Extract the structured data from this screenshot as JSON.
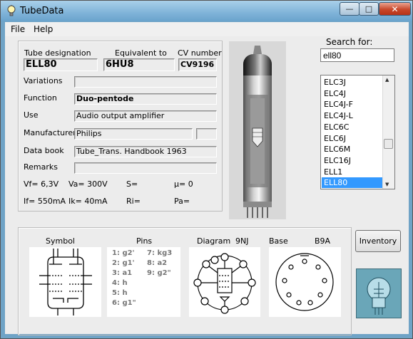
{
  "window": {
    "title": "TubeData"
  },
  "menu": {
    "file": "File",
    "help": "Help"
  },
  "search": {
    "label": "Search for:",
    "value": "ell80"
  },
  "tube_list": {
    "items": [
      "ELC3J",
      "ELC4J",
      "ELC4J-F",
      "ELC4J-L",
      "ELC6C",
      "ELC6J",
      "ELC6M",
      "ELC16J",
      "ELL1",
      "ELL80"
    ],
    "selected": "ELL80"
  },
  "info": {
    "designation_label": "Tube designation",
    "equivalent_label": "Equivalent to",
    "cv_label": "CV number",
    "designation": "ELL80",
    "equivalent": "6HU8",
    "cv": "CV9196",
    "variations_label": "Variations",
    "variations": "",
    "function_label": "Function",
    "function": "Duo-pentode",
    "use_label": "Use",
    "use": "Audio output amplifier",
    "manufacturer_label": "Manufacturer",
    "manufacturer": "Philips",
    "manufacturer_code": "",
    "databook_label": "Data book",
    "databook": "Tube_Trans. Handbook 1963",
    "remarks_label": "Remarks",
    "remarks": ""
  },
  "specs": {
    "vf": "Vf= 6,3V",
    "va": "Va=  300V",
    "s": "S=",
    "mu": "µ=   0",
    "if": "If= 550mA",
    "ik": "Ik=   40mA",
    "ri": "Ri=",
    "pa": "Pa="
  },
  "bottom": {
    "symbol_label": "Symbol",
    "pins_label": "Pins",
    "diagram_label": "Diagram",
    "diagram_code": "9NJ",
    "base_label": "Base",
    "base_code": "B9A"
  },
  "pins": {
    "left": [
      "1: g2'",
      "2: g1'",
      "3: a1",
      "4: h",
      "5: h",
      "6: g1\""
    ],
    "right": [
      "7: kg3",
      "8: a2",
      "9: g2\""
    ]
  },
  "buttons": {
    "inventory": "Inventory"
  },
  "colors": {
    "selection": "#3399ff",
    "titlebar": "#7fb3d8",
    "close": "#c8472a"
  }
}
